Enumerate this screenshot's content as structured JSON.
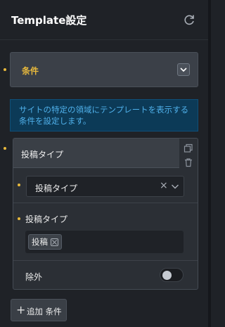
{
  "header": {
    "title": "Template設定"
  },
  "condition_section": {
    "label": "条件"
  },
  "info": {
    "text": "サイトの特定の領域にテンプレートを表示する条件を設定します。"
  },
  "group": {
    "title": "投稿タイプ",
    "select": {
      "value": "投稿タイプ"
    },
    "field_label": "投稿タイプ",
    "tags": [
      "投稿"
    ],
    "exclude_label": "除外",
    "exclude_enabled": false
  },
  "add_button": {
    "label": "追加 条件"
  },
  "colors": {
    "accent": "#e8b93c",
    "info_text": "#4fb0ea",
    "info_bg": "#0c3a57",
    "background": "#1f2227"
  }
}
